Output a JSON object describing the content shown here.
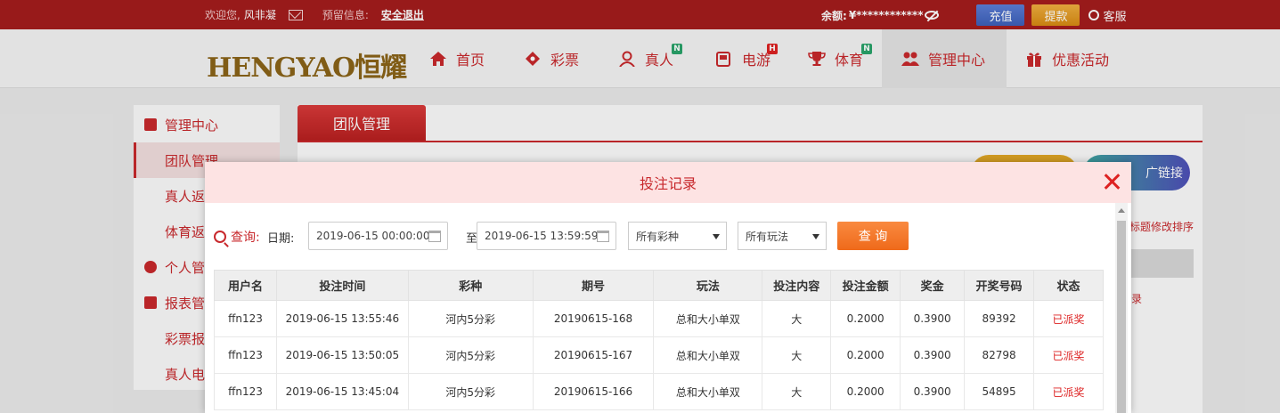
{
  "topbar": {
    "welcome": "欢迎您,",
    "username": "风非凝",
    "reserved_label": "预留信息:",
    "logout": "安全退出",
    "balance_label": "余额:",
    "balance_value": "¥************",
    "recharge": "充值",
    "withdraw": "提款",
    "customer_service": "客服"
  },
  "logo": {
    "text_a": "HENGYAO",
    "text_b": "恒耀"
  },
  "nav": {
    "items": [
      {
        "label": "首页",
        "icon": "home-icon",
        "badge": ""
      },
      {
        "label": "彩票",
        "icon": "lottery-icon",
        "badge": ""
      },
      {
        "label": "真人",
        "icon": "live-dealer-icon",
        "badge": "N"
      },
      {
        "label": "电游",
        "icon": "slot-machine-icon",
        "badge": "H"
      },
      {
        "label": "体育",
        "icon": "trophy-icon",
        "badge": "N"
      },
      {
        "label": "管理中心",
        "icon": "users-icon",
        "badge": ""
      },
      {
        "label": "优惠活动",
        "icon": "gift-icon",
        "badge": ""
      }
    ]
  },
  "sidebar": {
    "items": [
      {
        "label": "管理中心",
        "type": "head",
        "icon": "users-icon"
      },
      {
        "label": "团队管理",
        "type": "sub-selected"
      },
      {
        "label": "真人返",
        "type": "sub"
      },
      {
        "label": "体育返",
        "type": "sub"
      },
      {
        "label": "个人管",
        "type": "head",
        "icon": "user-icon"
      },
      {
        "label": "报表管",
        "type": "head",
        "icon": "report-icon"
      },
      {
        "label": "彩票报",
        "type": "sub"
      },
      {
        "label": "真人电",
        "type": "sub"
      }
    ]
  },
  "main": {
    "tab": "团队管理",
    "promo_link": "广链接",
    "sort_tip": "标题修改排序",
    "row_tip": "录"
  },
  "modal": {
    "title": "投注记录",
    "query_label": "查询:",
    "date_label": "日期:",
    "date_from": "2019-06-15 00:00:00",
    "to_label": "至",
    "date_to": "2019-06-15 13:59:59",
    "lottery_select": "所有彩种",
    "play_select": "所有玩法",
    "query_button": "查 询",
    "columns": [
      "用户名",
      "投注时间",
      "彩种",
      "期号",
      "玩法",
      "投注内容",
      "投注金额",
      "奖金",
      "开奖号码",
      "状态"
    ],
    "rows": [
      [
        "ffn123",
        "2019-06-15 13:55:46",
        "河内5分彩",
        "20190615-168",
        "总和大小单双",
        "大",
        "0.2000",
        "0.3900",
        "89392",
        "已派奖"
      ],
      [
        "ffn123",
        "2019-06-15 13:50:05",
        "河内5分彩",
        "20190615-167",
        "总和大小单双",
        "大",
        "0.2000",
        "0.3900",
        "82798",
        "已派奖"
      ],
      [
        "ffn123",
        "2019-06-15 13:45:04",
        "河内5分彩",
        "20190615-166",
        "总和大小单双",
        "大",
        "0.2000",
        "0.3900",
        "54895",
        "已派奖"
      ]
    ]
  },
  "colors": {
    "brand_red": "#c8282c",
    "topbar": "#a41c1c",
    "modal_header": "#fde3e3",
    "query_orange": "#ef6a1a"
  }
}
